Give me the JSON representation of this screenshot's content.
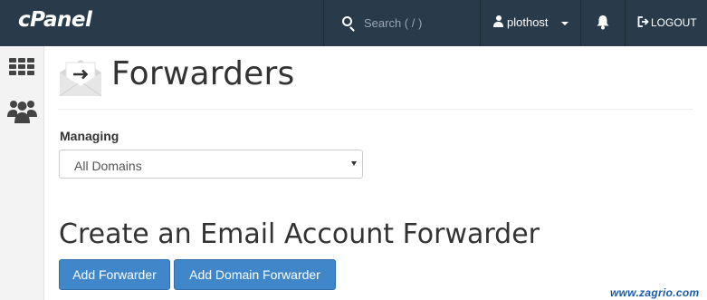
{
  "header": {
    "logo": "cPanel",
    "search_placeholder": "Search ( / )",
    "username": "plothost",
    "logout_label": "LOGOUT"
  },
  "page": {
    "title": "Forwarders",
    "managing_label": "Managing",
    "domain_select": {
      "selected": "All Domains"
    },
    "section_title": "Create an Email Account Forwarder",
    "add_forwarder_label": "Add Forwarder",
    "add_domain_forwarder_label": "Add Domain Forwarder"
  },
  "sidebar": {
    "icons": [
      "grid-icon",
      "users-icon"
    ]
  },
  "watermark": "www.zagrio.com",
  "colors": {
    "topbar": "#293a4a",
    "button": "#3f87c9",
    "sidebar": "#f3f3f3"
  }
}
